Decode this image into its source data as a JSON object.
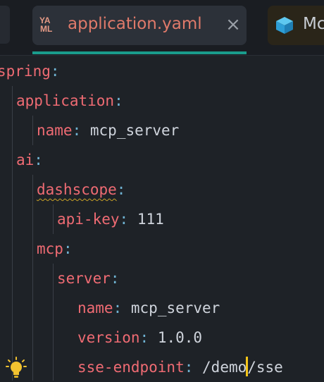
{
  "tabs": {
    "active": {
      "icon_top": "YA",
      "icon_bottom": "ML",
      "label": "application.yaml",
      "close": "×"
    },
    "next": {
      "label": "Mc"
    }
  },
  "editor": {
    "lines": [
      {
        "key": "spring",
        "colon": ":"
      },
      {
        "key": "application",
        "colon": ":"
      },
      {
        "key": "name",
        "colon": ":",
        "value": "mcp_server"
      },
      {
        "key": "ai",
        "colon": ":"
      },
      {
        "key": "dashscope",
        "colon": ":"
      },
      {
        "key": "api-key",
        "colon": ":",
        "value": "111"
      },
      {
        "key": "mcp",
        "colon": ":"
      },
      {
        "key": "server",
        "colon": ":"
      },
      {
        "key": "name",
        "colon": ":",
        "value": "mcp_server"
      },
      {
        "key": "version",
        "colon": ":",
        "value": "1.0.0"
      },
      {
        "key": "sse-endpoint",
        "colon": ":",
        "value_before_caret": "/demo",
        "value_after_caret": "/sse"
      }
    ]
  },
  "colors": {
    "key": "#ef6b73",
    "punctuation": "#6fb3d2",
    "value": "#cfd4dc",
    "tab_accent": "#1a9c8c",
    "caret": "#f5c518"
  },
  "icons": {
    "yaml_file": "yaml-file-icon",
    "module": "cube-icon",
    "intention": "lightbulb-icon"
  }
}
